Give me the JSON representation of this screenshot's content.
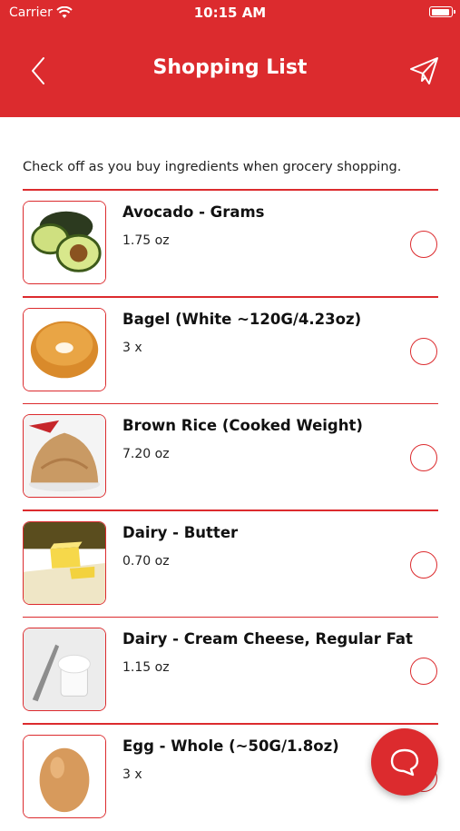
{
  "status_bar": {
    "carrier": "Carrier",
    "time": "10:15 AM"
  },
  "header": {
    "title": "Shopping List",
    "back_icon": "chevron-left-icon",
    "send_icon": "paper-plane-icon"
  },
  "intro_text": "Check off as you buy ingredients when grocery shopping.",
  "items": [
    {
      "name": "Avocado - Grams",
      "qty": "1.75 oz",
      "image": "avocado"
    },
    {
      "name": "Bagel (White ~120G/4.23oz)",
      "qty": "3 x",
      "image": "bagel"
    },
    {
      "name": "Brown Rice (Cooked Weight)",
      "qty": "7.20 oz",
      "image": "brown-rice"
    },
    {
      "name": "Dairy - Butter",
      "qty": "0.70 oz",
      "image": "butter"
    },
    {
      "name": "Dairy - Cream Cheese, Regular Fat",
      "qty": "1.15 oz",
      "image": "cream-cheese"
    },
    {
      "name": "Egg - Whole (~50G/1.8oz)",
      "qty": "3 x",
      "image": "egg"
    }
  ],
  "fab": {
    "icon": "chat-bubble-icon"
  },
  "colors": {
    "accent": "#dc2b2e",
    "background": "#ffffff"
  }
}
